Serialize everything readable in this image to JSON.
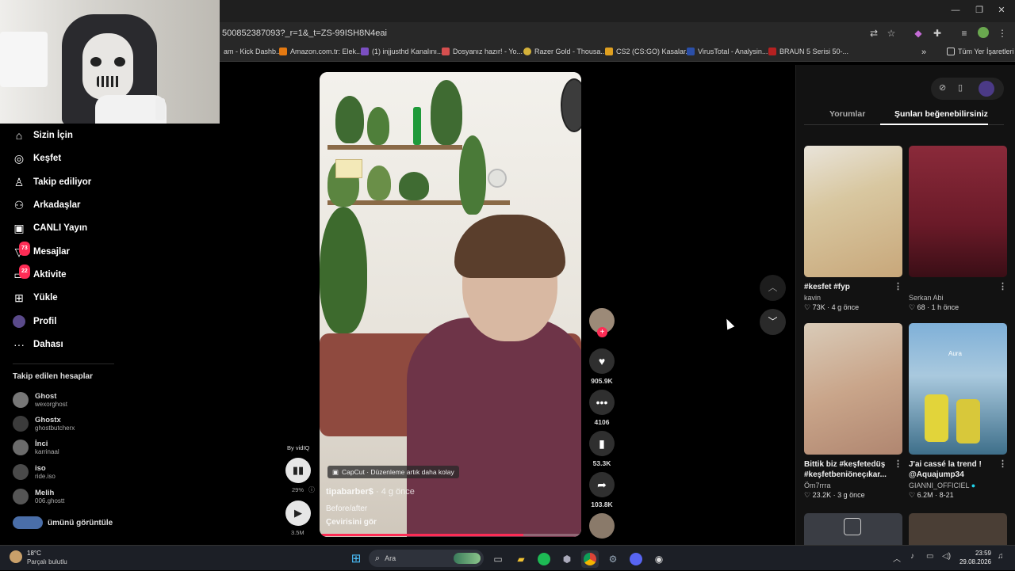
{
  "browser": {
    "url": "500852387093?_r=1&_t=ZS-99ISH8N4eai",
    "bookmarks": [
      "am - Kick Dashb...",
      "Amazon.com.tr: Elek...",
      "(1) injjusthd Kanalını...",
      "Dosyanız hazır! - Yo...",
      "Razer Gold - Thousa...",
      "CS2 (CS:GO) Kasalar...",
      "VirusTotal - Analysin...",
      "BRAUN 5 Serisi 50-..."
    ],
    "bookmarks_more": "»",
    "all_bookmarks": "Tüm Yer İşaretleri"
  },
  "nav": {
    "items": [
      {
        "label": "Sizin İçin",
        "icon": "home-icon"
      },
      {
        "label": "Keşfet",
        "icon": "compass-icon"
      },
      {
        "label": "Takip ediliyor",
        "icon": "person-icon"
      },
      {
        "label": "Arkadaşlar",
        "icon": "friends-icon"
      },
      {
        "label": "CANLI Yayın",
        "icon": "live-icon"
      },
      {
        "label": "Mesajlar",
        "icon": "messages-icon",
        "badge": "73"
      },
      {
        "label": "Aktivite",
        "icon": "activity-icon",
        "badge": "22"
      },
      {
        "label": "Yükle",
        "icon": "upload-icon"
      },
      {
        "label": "Profil",
        "icon": "profile-icon"
      },
      {
        "label": "Dahası",
        "icon": "more-icon"
      }
    ],
    "following_heading": "Takip edilen hesaplar",
    "accounts": [
      {
        "name": "Ghost",
        "username": "wexorghost"
      },
      {
        "name": "Ghostx",
        "username": "ghostbutcherx"
      },
      {
        "name": "İnci",
        "username": "karrinaal"
      },
      {
        "name": "iso",
        "username": "ride.iso"
      },
      {
        "name": "Melih",
        "username": "006.ghostt"
      }
    ],
    "see_all": "ümünü görüntüle"
  },
  "video": {
    "capcut": "CapCut · Düzenleme artık daha kolay",
    "author": "tipabarber$",
    "time": "· 4 g önce",
    "description": "Before/after",
    "translate": "Çevirisini gör",
    "progress": 0.78
  },
  "vidiq": {
    "by": "By vidIQ",
    "percent": "29%",
    "views": "3.5M"
  },
  "actions": {
    "likes": "905.9K",
    "comments": "4106",
    "saves": "53.3K",
    "shares": "103.8K"
  },
  "panel": {
    "tab_comments": "Yorumlar",
    "tab_suggested": "Şunları beğenebilirsiniz",
    "cards": [
      {
        "title": "#kesfet #fyp",
        "author": "kavin",
        "likes": "73K",
        "age": "4 g önce"
      },
      {
        "title": "",
        "author": "Serkan Abi",
        "likes": "68",
        "age": "1 h önce"
      },
      {
        "title": "Bittik biz #keşfetedüş #keşfetbeniöneçıkar...",
        "author": "Öm7rrra",
        "likes": "23.2K",
        "age": "3 g önce"
      },
      {
        "title": "J'ai cassé la trend ! @Aquajump34",
        "author": "GIANNI_OFFICIEL",
        "likes": "6.2M",
        "age": "8-21"
      }
    ],
    "thumb_overlay": "Aura"
  },
  "taskbar": {
    "weather_temp": "18°C",
    "weather_desc": "Parçalı bulutlu",
    "search_placeholder": "Ara",
    "time": "23:59",
    "date": "29.08.2026"
  },
  "colors": {
    "accent": "#fe2c55",
    "background": "#000000",
    "panel": "#121212"
  }
}
